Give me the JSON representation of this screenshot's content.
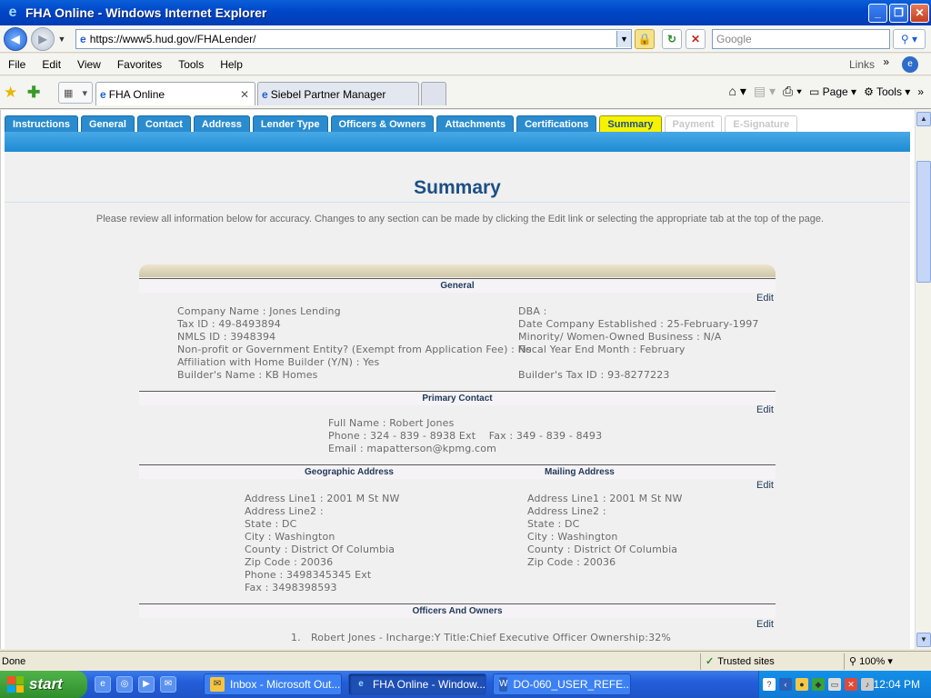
{
  "window": {
    "title": "FHA Online - Windows Internet Explorer"
  },
  "address_bar": {
    "url": "https://www5.hud.gov/FHALender/",
    "search_placeholder": "Google"
  },
  "menu": {
    "items": [
      "File",
      "Edit",
      "View",
      "Favorites",
      "Tools",
      "Help"
    ],
    "links": "Links"
  },
  "browser_tabs": [
    {
      "label": "FHA Online"
    },
    {
      "label": "Siebel Partner Manager"
    }
  ],
  "command_bar": {
    "page": "Page",
    "tools": "Tools"
  },
  "app_tabs": [
    {
      "label": "Instructions",
      "state": "normal"
    },
    {
      "label": "General",
      "state": "normal"
    },
    {
      "label": "Contact",
      "state": "normal"
    },
    {
      "label": "Address",
      "state": "normal"
    },
    {
      "label": "Lender Type",
      "state": "normal"
    },
    {
      "label": "Officers & Owners",
      "state": "normal"
    },
    {
      "label": "Attachments",
      "state": "normal"
    },
    {
      "label": "Certifications",
      "state": "normal"
    },
    {
      "label": "Summary",
      "state": "selected"
    },
    {
      "label": "Payment",
      "state": "disabled"
    },
    {
      "label": "E-Signature",
      "state": "disabled"
    }
  ],
  "page": {
    "title": "Summary",
    "intro": "Please review all information below for accuracy. Changes to any section can be made by clicking the Edit link or selecting the appropriate tab at the top of the page.",
    "edit_label": "Edit"
  },
  "general": {
    "header": "General",
    "left": [
      "Company Name : Jones Lending",
      "Tax ID : 49-8493894",
      "NMLS ID : 3948394",
      "Non-profit or Government Entity? (Exempt from Application Fee) : No",
      "Affiliation with Home Builder (Y/N) : Yes",
      "Builder's Name : KB Homes"
    ],
    "right": [
      "DBA :",
      "Date Company Established : 25-February-1997",
      "Minority/ Women-Owned Business : N/A",
      "Fiscal Year End Month : February",
      "Builder's Tax ID : 93-8277223"
    ]
  },
  "primary_contact": {
    "header": "Primary Contact",
    "lines": [
      "Full Name : Robert Jones",
      "Phone : 324 - 839 - 8938 Ext    Fax : 349 - 839 - 8493",
      "Email : mapatterson@kpmg.com"
    ]
  },
  "address": {
    "geo_header": "Geographic Address",
    "mail_header": "Mailing Address",
    "geo": [
      "Address Line1 : 2001 M St NW",
      "Address Line2 :",
      "State : DC",
      "City : Washington",
      "County : District Of Columbia",
      "Zip Code : 20036",
      "Phone : 3498345345 Ext",
      "Fax : 3498398593"
    ],
    "mail": [
      "Address Line1 : 2001 M St NW",
      "Address Line2 :",
      "State : DC",
      "City : Washington",
      "County : District Of Columbia",
      "Zip Code : 20036"
    ]
  },
  "officers": {
    "header": "Officers And Owners",
    "items": [
      {
        "num": "1.",
        "text": "Robert Jones - Incharge:Y Title:Chief Executive Officer Ownership:32%"
      }
    ]
  },
  "status": {
    "left": "Done",
    "zone": "Trusted sites",
    "zoom": "100%"
  },
  "taskbar": {
    "start": "start",
    "tasks": [
      "Inbox - Microsoft Out...",
      "FHA Online - Window...",
      "DO-060_USER_REFE..."
    ],
    "clock": "12:04 PM"
  }
}
